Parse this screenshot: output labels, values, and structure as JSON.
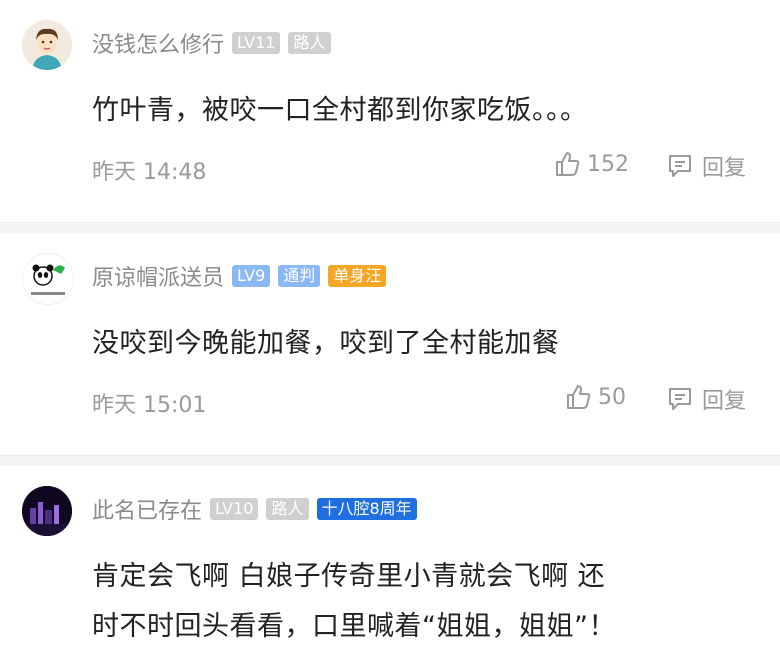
{
  "comments": [
    {
      "username": "没钱怎么修行",
      "badges": [
        "LV11",
        "路人"
      ],
      "text": "竹叶青，被咬一口全村都到你家吃饭。。。",
      "time": "昨天 14:48",
      "likes": "152",
      "reply_label": "回复"
    },
    {
      "username": "原谅帽派送员",
      "badges": [
        "LV9",
        "通判",
        "单身汪"
      ],
      "text": "没咬到今晚能加餐，咬到了全村能加餐",
      "time": "昨天 15:01",
      "likes": "50",
      "reply_label": "回复"
    },
    {
      "username": "此名已存在",
      "badges": [
        "LV10",
        "路人",
        "十八腔8周年"
      ],
      "text_lines": [
        "肯定会飞啊 白娘子传奇里小青就会飞啊 还",
        "时不时回头看看，口里喊着“姐姐，姐姐”！"
      ]
    }
  ],
  "icons": {
    "like": "thumbs-up-icon",
    "reply": "comment-bubble-icon"
  },
  "colors": {
    "text": "#222222",
    "meta": "#9a9a9a",
    "badge_gray": "#d0d0d0",
    "badge_blue": "#8ab8f3",
    "badge_orange": "#f5a623",
    "badge_deepblue": "#1f6fe0"
  }
}
